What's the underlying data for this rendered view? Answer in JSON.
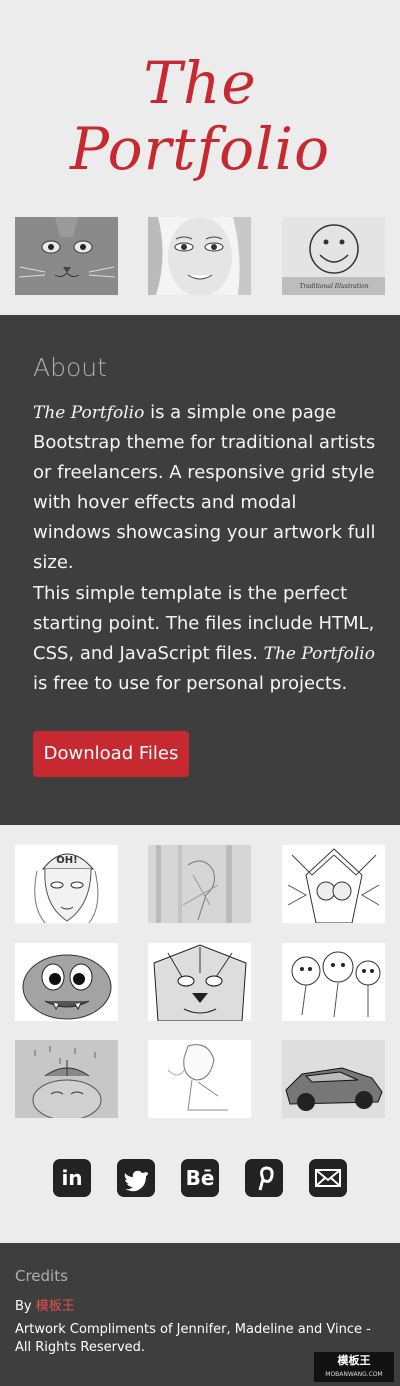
{
  "brand": {
    "line1": "The",
    "line2": "Portfolio",
    "color": "#c62a30"
  },
  "about": {
    "heading": "About",
    "p1_brand": "The Portfolio",
    "p1_text": " is a simple one page Bootstrap theme for traditional artists or freelancers. A responsive grid style with hover effects and modal windows showcasing your artwork full size.",
    "p2_text": "This simple template is the perfect starting point. The files include HTML, CSS, and JavaScript files. ",
    "p2_brand": "The Portfolio",
    "p2_end": " is free to use for personal projects.",
    "download_label": "Download Files"
  },
  "hero_gallery": [
    {
      "icon": "cat-drawing"
    },
    {
      "icon": "girl-portrait-drawing"
    },
    {
      "icon": "smiley-drawing",
      "caption": "Traditional Illustration"
    }
  ],
  "gallery": [
    {
      "icon": "girl-cap-drawing",
      "cap_text": "OH!"
    },
    {
      "icon": "sketch-drawing"
    },
    {
      "icon": "tribal-figure-drawing"
    },
    {
      "icon": "monster-drawing"
    },
    {
      "icon": "lion-drawing"
    },
    {
      "icon": "cartoon-girls-drawing"
    },
    {
      "icon": "rain-face-drawing"
    },
    {
      "icon": "anime-girl-drawing"
    },
    {
      "icon": "sports-car-drawing"
    }
  ],
  "social": {
    "linkedin": "in",
    "twitter": "twitter-icon",
    "behance": "Bē",
    "pinterest": "pinterest-icon",
    "mail": "mail-icon"
  },
  "footer": {
    "credits": "Credits",
    "by_prefix": "By ",
    "by_link": "模板王",
    "rights": "Artwork Compliments of Jennifer, Madeline and Vince - All Rights Reserved."
  },
  "watermark": {
    "text": "模板王",
    "url_text": "MOBANWANG.COM"
  }
}
